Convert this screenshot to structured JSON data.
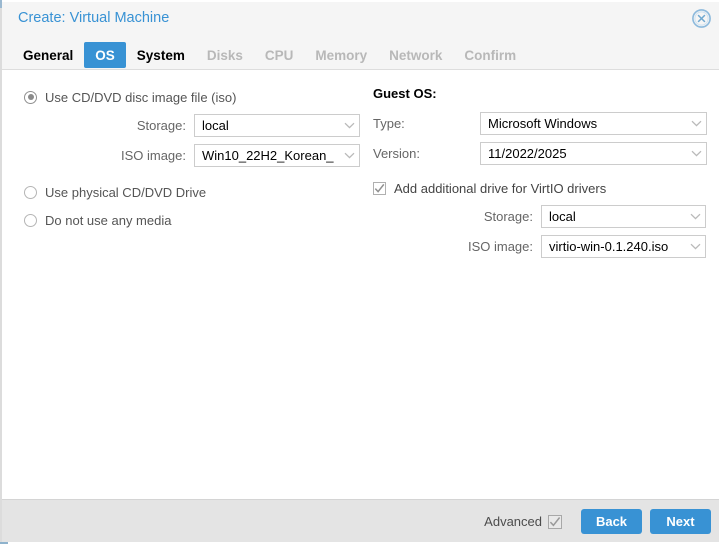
{
  "window": {
    "title": "Create: Virtual Machine",
    "title_color": "#3892d4",
    "close_icon": "close-circle-icon"
  },
  "tabs": [
    {
      "label": "General",
      "state": "enabled"
    },
    {
      "label": "OS",
      "state": "active"
    },
    {
      "label": "System",
      "state": "enabled"
    },
    {
      "label": "Disks",
      "state": "disabled"
    },
    {
      "label": "CPU",
      "state": "disabled"
    },
    {
      "label": "Memory",
      "state": "disabled"
    },
    {
      "label": "Network",
      "state": "disabled"
    },
    {
      "label": "Confirm",
      "state": "disabled"
    }
  ],
  "media": {
    "options": [
      {
        "label": "Use CD/DVD disc image file (iso)",
        "selected": true
      },
      {
        "label": "Use physical CD/DVD Drive",
        "selected": false
      },
      {
        "label": "Do not use any media",
        "selected": false
      }
    ],
    "storage_label": "Storage:",
    "storage_value": "local",
    "iso_label": "ISO image:",
    "iso_value": "Win10_22H2_Korean_"
  },
  "guest_os": {
    "section_label": "Guest OS:",
    "type_label": "Type:",
    "type_value": "Microsoft Windows",
    "version_label": "Version:",
    "version_value": "11/2022/2025"
  },
  "virtio": {
    "checkbox_label": "Add additional drive for VirtIO drivers",
    "checked": true,
    "storage_label": "Storage:",
    "storage_value": "local",
    "iso_label": "ISO image:",
    "iso_value": "virtio-win-0.1.240.iso"
  },
  "footer": {
    "advanced_label": "Advanced",
    "advanced_checked": true,
    "back_label": "Back",
    "next_label": "Next",
    "button_color": "#3892d4"
  }
}
